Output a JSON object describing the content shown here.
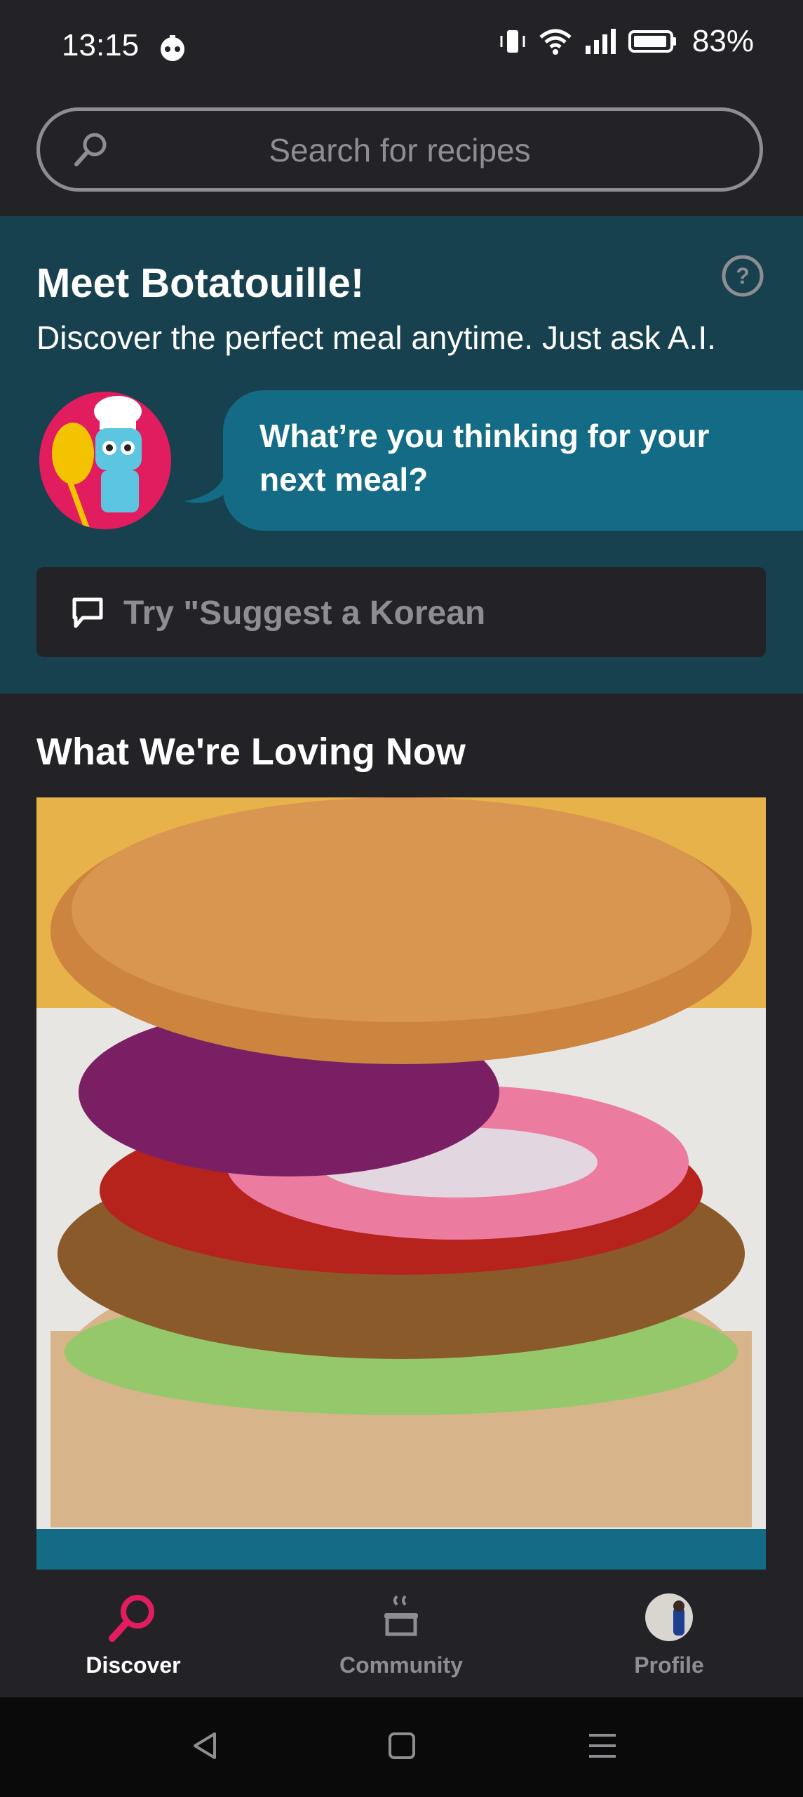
{
  "status_bar": {
    "time": "13:15",
    "battery": "83%",
    "icons": [
      "bot-icon",
      "vibrate-icon",
      "wifi-icon",
      "signal-icon",
      "battery-icon"
    ]
  },
  "search": {
    "placeholder": "Search for recipes"
  },
  "bot_section": {
    "title": "Meet Botatouille!",
    "subtitle": "Discover the perfect meal anytime. Just ask A.I.",
    "bubble_text": "What’re you thinking for your next meal?",
    "ask_placeholder": "Try \"Suggest a Korean",
    "colors": {
      "section_bg": "#18414f",
      "bubble_bg": "#136b85",
      "avatar_bg": "#e11d5f"
    }
  },
  "loving_now": {
    "title": "What We're Loving Now",
    "feature_image": "veggie-burger-photo"
  },
  "bottom_nav": {
    "items": [
      {
        "label": "Discover",
        "icon": "discover-search-icon",
        "active": true
      },
      {
        "label": "Community",
        "icon": "pot-icon",
        "active": false
      },
      {
        "label": "Profile",
        "icon": "avatar",
        "active": false
      }
    ],
    "colors": {
      "active": "#e11d5f",
      "inactive": "#8e8d92"
    }
  },
  "system_nav": {
    "icons": [
      "back-icon",
      "home-icon",
      "recents-icon"
    ]
  }
}
